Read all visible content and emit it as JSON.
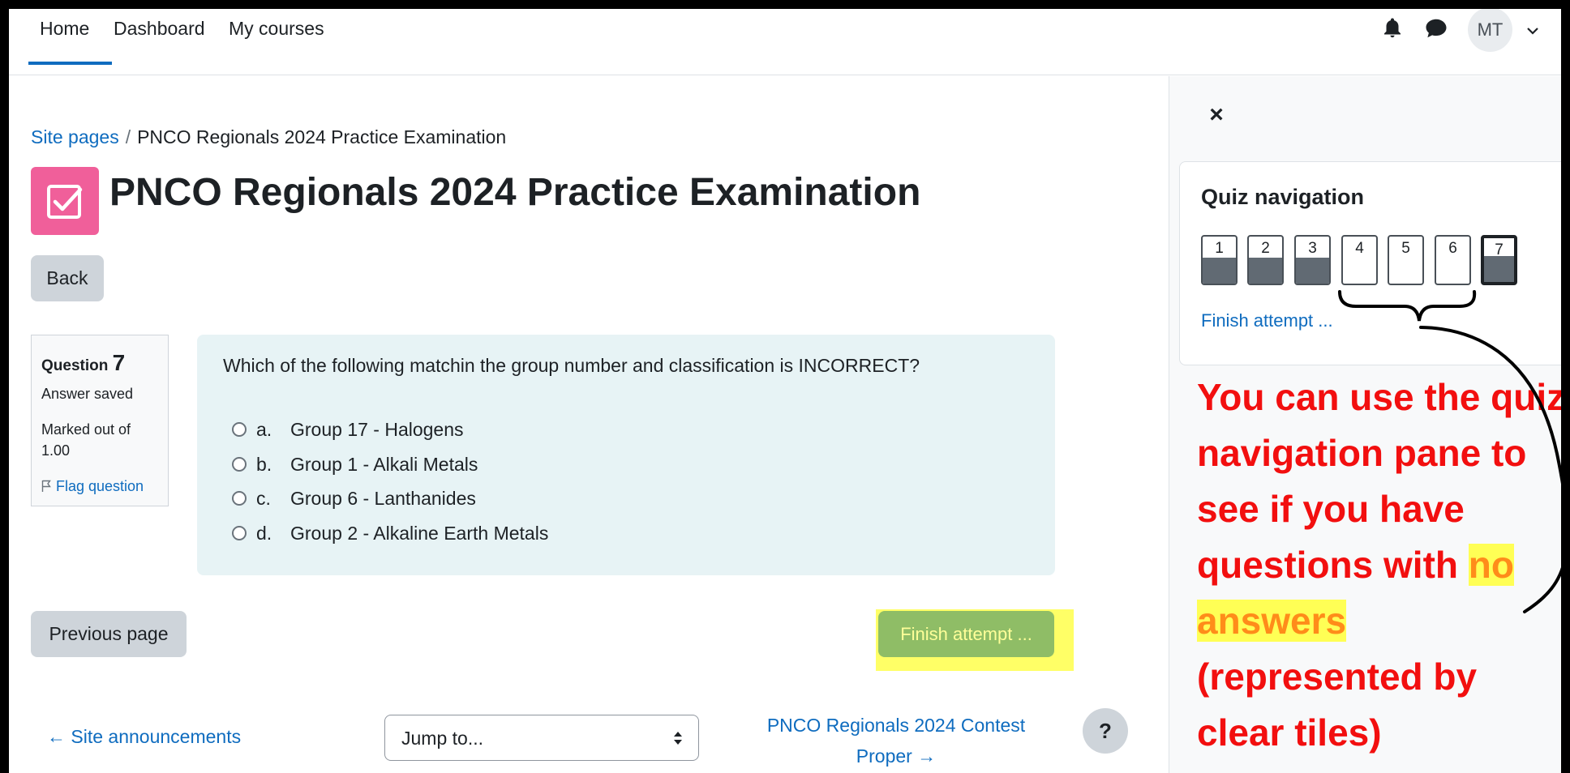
{
  "nav": {
    "items": [
      "Home",
      "Dashboard",
      "My courses"
    ],
    "active": "Home",
    "avatar_initials": "MT"
  },
  "breadcrumb": {
    "link": "Site pages",
    "separator": "/",
    "current": "PNCO Regionals 2024 Practice Examination"
  },
  "page": {
    "title": "PNCO Regionals 2024 Practice Examination",
    "back_label": "Back"
  },
  "question_info": {
    "label": "Question",
    "number": "7",
    "state": "Answer saved",
    "marks": "Marked out of 1.00",
    "flag_label": "Flag question"
  },
  "question": {
    "text": "Which of the following matchin the group number and classification is INCORRECT?",
    "options": [
      {
        "letter": "a.",
        "text": "Group 17 - Halogens"
      },
      {
        "letter": "b.",
        "text": "Group 1 - Alkali Metals"
      },
      {
        "letter": "c.",
        "text": "Group 6 - Lanthanides"
      },
      {
        "letter": "d.",
        "text": "Group 2 - Alkaline Earth Metals"
      }
    ]
  },
  "buttons": {
    "previous_page": "Previous page",
    "finish_attempt": "Finish attempt ..."
  },
  "footer_nav": {
    "prev_activity": "← Site announcements",
    "jump_to": "Jump to...",
    "next_activity": "PNCO Regionals 2024 Contest Proper →",
    "help": "?"
  },
  "quiz_navigation": {
    "title": "Quiz navigation",
    "tiles": [
      {
        "label": "1",
        "answered": true
      },
      {
        "label": "2",
        "answered": true
      },
      {
        "label": "3",
        "answered": true
      },
      {
        "label": "4",
        "answered": false
      },
      {
        "label": "5",
        "answered": false
      },
      {
        "label": "6",
        "answered": false
      },
      {
        "label": "7",
        "answered": true,
        "current": true
      }
    ],
    "finish_link": "Finish attempt ...",
    "close_label": "×"
  },
  "annotation": {
    "before": "You can use the quiz navigation pane to see if you have questions with ",
    "highlight": "no answers",
    "after": " (represented by clear tiles)"
  },
  "colors": {
    "accent": "#0f6cbf",
    "quiz_icon": "#f05f9a",
    "question_bg": "#e7f3f5",
    "annotation_red": "#f20f0f",
    "highlight_yellow": "#ffff55",
    "finish_btn": "#8fbd66"
  }
}
